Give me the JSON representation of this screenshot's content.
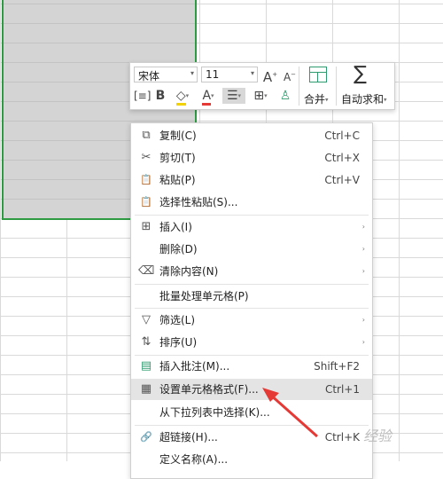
{
  "toolbar": {
    "font_name": "宋体",
    "font_size": "11",
    "bold": "B",
    "increase_font": "A",
    "decrease_font": "A",
    "font_color_glyph": "A",
    "merge_label": "合并",
    "autosum_label": "自动求和",
    "dropdown_mark": "▾"
  },
  "menu": {
    "items": [
      {
        "icon": "copy-icon",
        "glyph": "⧉",
        "label": "复制(C)",
        "shortcut": "Ctrl+C"
      },
      {
        "icon": "scissors-icon",
        "glyph": "✂",
        "label": "剪切(T)",
        "shortcut": "Ctrl+X"
      },
      {
        "icon": "paste-icon",
        "glyph": "📋",
        "label": "粘贴(P)",
        "shortcut": "Ctrl+V"
      },
      {
        "icon": "paste-special-icon",
        "glyph": "📋",
        "label": "选择性粘贴(S)..."
      },
      {
        "icon": "insert-icon",
        "glyph": "⊞",
        "label": "插入(I)",
        "submenu": "›"
      },
      {
        "icon": "",
        "glyph": "",
        "label": "删除(D)",
        "submenu": "›"
      },
      {
        "icon": "eraser-icon",
        "glyph": "⌫",
        "label": "清除内容(N)",
        "submenu": "›"
      },
      {
        "icon": "",
        "glyph": "",
        "label": "批量处理单元格(P)"
      },
      {
        "icon": "filter-icon",
        "glyph": "▽",
        "label": "筛选(L)",
        "submenu": "›"
      },
      {
        "icon": "sort-icon",
        "glyph": "⇅",
        "label": "排序(U)",
        "submenu": "›"
      },
      {
        "icon": "comment-icon",
        "glyph": "▤",
        "label": "插入批注(M)...",
        "shortcut": "Shift+F2"
      },
      {
        "icon": "format-cells-icon",
        "glyph": "▦",
        "label": "设置单元格格式(F)...",
        "shortcut": "Ctrl+1"
      },
      {
        "icon": "",
        "glyph": "",
        "label": "从下拉列表中选择(K)..."
      },
      {
        "icon": "link-icon",
        "glyph": "🔗",
        "label": "超链接(H)...",
        "shortcut": "Ctrl+K"
      },
      {
        "icon": "",
        "glyph": "",
        "label": "定义名称(A)..."
      }
    ]
  },
  "watermark": "经验"
}
